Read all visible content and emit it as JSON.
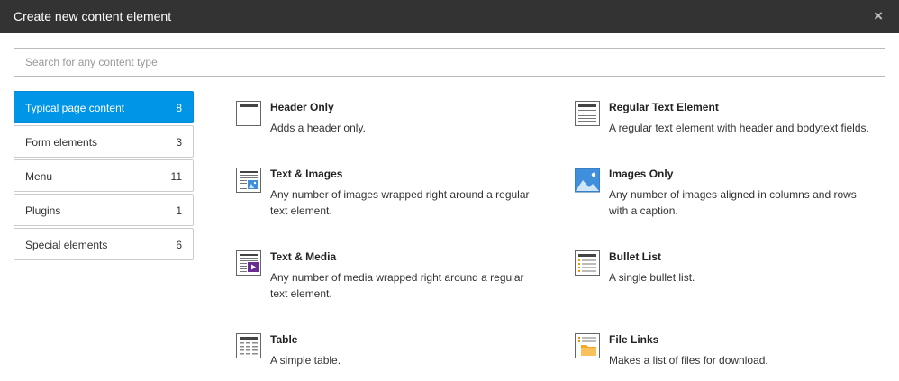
{
  "dialog": {
    "title": "Create new content element",
    "close_label": "×"
  },
  "search": {
    "placeholder": "Search for any content type",
    "value": ""
  },
  "sidebar": {
    "items": [
      {
        "label": "Typical page content",
        "count": "8",
        "active": true
      },
      {
        "label": "Form elements",
        "count": "3"
      },
      {
        "label": "Menu",
        "count": "11"
      },
      {
        "label": "Plugins",
        "count": "1"
      },
      {
        "label": "Special elements",
        "count": "6"
      }
    ]
  },
  "elements": [
    {
      "name": "Header Only",
      "desc": "Adds a header only.",
      "icon": "header-only-icon"
    },
    {
      "name": "Regular Text Element",
      "desc": "A regular text element with header and bodytext fields.",
      "icon": "regular-text-icon"
    },
    {
      "name": "Text & Images",
      "desc": "Any number of images wrapped right around a regular text element.",
      "icon": "text-images-icon"
    },
    {
      "name": "Images Only",
      "desc": "Any number of images aligned in columns and rows with a caption.",
      "icon": "images-only-icon"
    },
    {
      "name": "Text & Media",
      "desc": "Any number of media wrapped right around a regular text element.",
      "icon": "text-media-icon"
    },
    {
      "name": "Bullet List",
      "desc": "A single bullet list.",
      "icon": "bullet-list-icon"
    },
    {
      "name": "Table",
      "desc": "A simple table.",
      "icon": "table-icon"
    },
    {
      "name": "File Links",
      "desc": "Makes a list of files for download.",
      "icon": "file-links-icon"
    }
  ],
  "colors": {
    "header_bg": "#333333",
    "active_bg": "#0095e6",
    "media_purple": "#6b2c91",
    "image_blue": "#3f8fdc",
    "bullet_orange": "#f29400"
  }
}
